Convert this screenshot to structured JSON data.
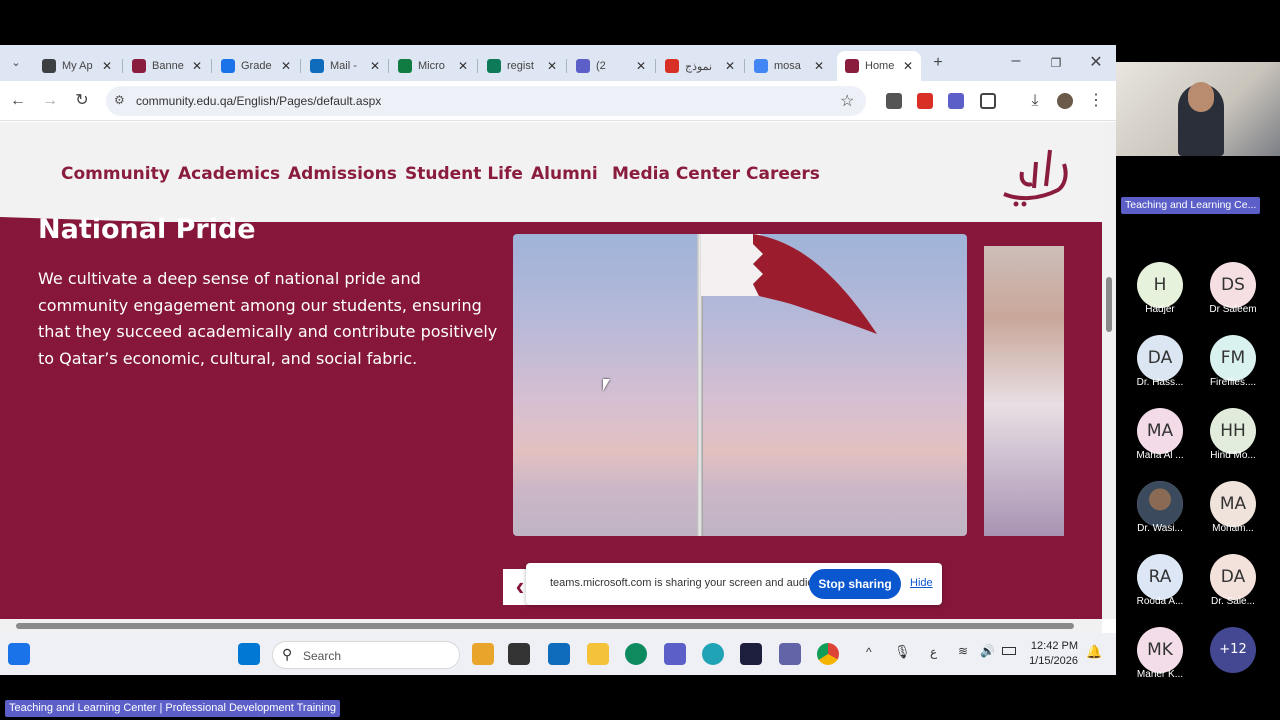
{
  "browser": {
    "tabs": [
      {
        "title": "My Ap",
        "color": "#3c4043"
      },
      {
        "title": "Banne",
        "color": "#8a1d3e"
      },
      {
        "title": "Grade",
        "color": "#1a73e8"
      },
      {
        "title": "Mail -",
        "color": "#0f6cbd"
      },
      {
        "title": "Micro",
        "color": "#107c41"
      },
      {
        "title": "regist",
        "color": "#0e7a58"
      },
      {
        "title": "(2",
        "color": "#5b5fc7"
      },
      {
        "title": "نموذج",
        "color": "#d93025"
      },
      {
        "title": "mosa",
        "color": "#4285f4"
      },
      {
        "title": "Home",
        "color": "#8a1d3e"
      }
    ],
    "url": "community.edu.qa/English/Pages/default.aspx"
  },
  "site": {
    "nav": [
      "Community",
      "Academics",
      "Admissions",
      "Student Life",
      "Alumni",
      "Media Center",
      "Careers"
    ],
    "section_title": "National Pride",
    "section_body": "We cultivate a deep sense of national pride and community engagement among our students, ensuring that they succeed academically and contribute positively to Qatar’s economic, cultural, and social fabric.",
    "brand_color": "#86173a"
  },
  "share_banner": {
    "text": "teams.microsoft.com is sharing your screen and audio.",
    "stop_label": "Stop sharing",
    "hide_label": "Hide"
  },
  "taskbar": {
    "search_label": "Search",
    "time": "12:42 PM",
    "date": "1/15/2026"
  },
  "teams": {
    "presenter_label": "Teaching and Learning Ce...",
    "participants": [
      {
        "initials": "H",
        "name": "Hadjer",
        "color": "#e6f2dc"
      },
      {
        "initials": "DS",
        "name": "Dr Saleem",
        "color": "#f6dfe3"
      },
      {
        "initials": "DA",
        "name": "Dr. Hass...",
        "color": "#dce6f2"
      },
      {
        "initials": "FM",
        "name": "Fireflies....",
        "color": "#d9f1ef"
      },
      {
        "initials": "MA",
        "name": "Maha Al ...",
        "color": "#f3dbe8"
      },
      {
        "initials": "HH",
        "name": "Hind Mo...",
        "color": "#e2ecdc"
      },
      {
        "initials": "",
        "name": "Dr. Wasi...",
        "color": "#e8e8e8"
      },
      {
        "initials": "MA",
        "name": "Moham...",
        "color": "#f0e3dc"
      },
      {
        "initials": "RA",
        "name": "Rooda A...",
        "color": "#dce6f5"
      },
      {
        "initials": "DA",
        "name": "Dr. Sale...",
        "color": "#f3e1dc"
      },
      {
        "initials": "MK",
        "name": "Maher K...",
        "color": "#f3dde8"
      },
      {
        "initials": "+12",
        "name": "",
        "color": "#444791"
      }
    ],
    "bottom_label": "Teaching and Learning Center | Professional Development Training"
  }
}
